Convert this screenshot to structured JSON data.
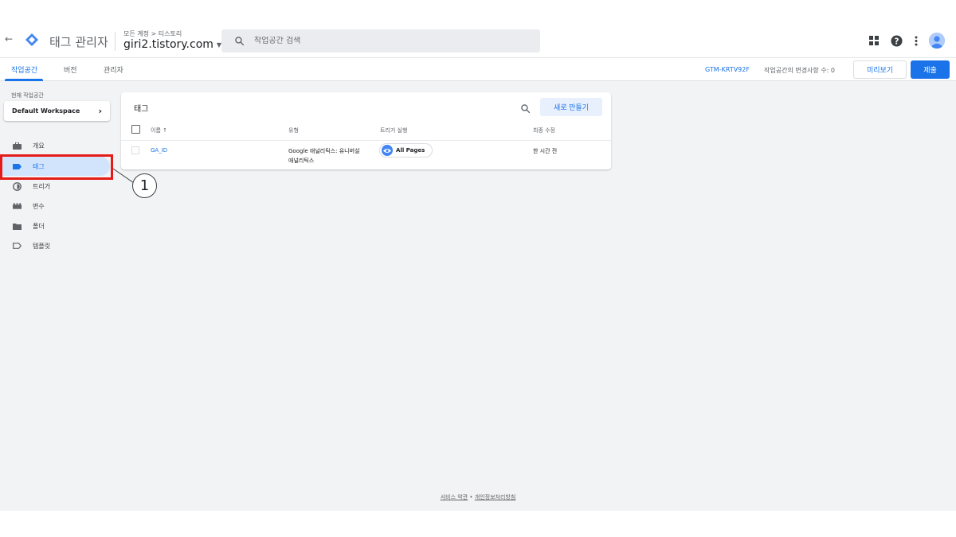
{
  "header": {
    "back": "←",
    "app_title": "태그 관리자",
    "account_breadcrumb": "모든 계정 > 티스토리",
    "container_name": "giri2.tistory.com",
    "search_placeholder": "작업공간 검색"
  },
  "subnav": {
    "tabs": [
      {
        "label": "작업공간",
        "active": true
      },
      {
        "label": "버전",
        "active": false
      },
      {
        "label": "관리자",
        "active": false
      }
    ],
    "container_id": "GTM-KRTV92F",
    "changes_text": "작업공간의 변경사항 수: 0",
    "preview_label": "미리보기",
    "submit_label": "제출"
  },
  "sidebar": {
    "workspace_label": "현재 작업공간",
    "workspace_name": "Default Workspace",
    "items": [
      {
        "label": "개요",
        "icon": "briefcase-icon",
        "active": false
      },
      {
        "label": "태그",
        "icon": "tag-icon",
        "active": true
      },
      {
        "label": "트리거",
        "icon": "trigger-icon",
        "active": false
      },
      {
        "label": "변수",
        "icon": "variables-icon",
        "active": false
      },
      {
        "label": "폴더",
        "icon": "folder-icon",
        "active": false
      },
      {
        "label": "템플릿",
        "icon": "template-icon",
        "active": false
      }
    ]
  },
  "annotation": {
    "callout_number": "1",
    "highlight_color": "#e41b17"
  },
  "tags_card": {
    "title": "태그",
    "new_button": "새로 만들기",
    "columns": [
      "이름 ↑",
      "유형",
      "트리거 실행",
      "최종 수정"
    ],
    "rows": [
      {
        "name": "GA_ID",
        "type_line1": "Google 애널리틱스: 유니버설",
        "type_line2": "애널리틱스",
        "trigger": "All Pages",
        "modified": "한 시간 전"
      }
    ]
  },
  "footer": {
    "terms": "서비스 약관",
    "separator": "•",
    "privacy": "개인정보처리방침"
  },
  "colors": {
    "accent": "#1a73e8",
    "background": "#f1f3f4",
    "active_nav": "#d2e3fc"
  }
}
